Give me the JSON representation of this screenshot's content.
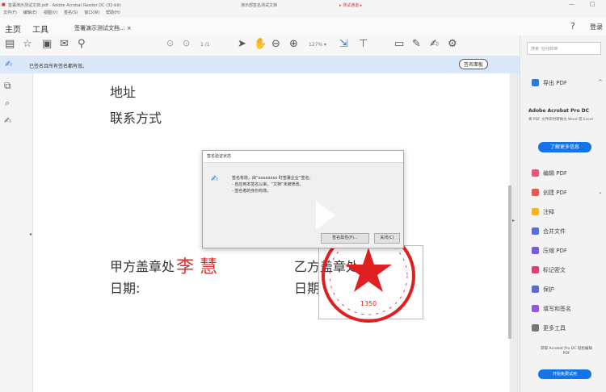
{
  "window": {
    "title": "签署演示测试文档.pdf - Adobe Acrobat Reader DC (32-bit)",
    "center_title": "演示部签名测试文档",
    "tab_status": "▸ 测试通道 ▸"
  },
  "menu": [
    "文件(F)",
    "编辑(E)",
    "视图(V)",
    "签名(S)",
    "窗口(W)",
    "帮助(H)"
  ],
  "tabs": {
    "home": "主页",
    "tools": "工具",
    "document": "签署演示测试文档... ×",
    "login": "登录"
  },
  "toolbar": {
    "page": "1 /1",
    "zoom": "127% ▾"
  },
  "notice": {
    "text": "已签名且所有签名都有效。",
    "panel_button": "签名面板"
  },
  "document": {
    "address": "地址",
    "contact": "联系方式",
    "party_a_seal": "甲方盖章处",
    "party_b_seal": "乙方盖章处",
    "date_label_a": "日期:",
    "date_label_b": "日期",
    "signature": "李 慧",
    "stamp_code": "1350"
  },
  "dialog": {
    "title": "签名验证状态",
    "lines": [
      "签名有效，由“xxxxxxxx 盯签署企业”签名。",
      "- 自应用本签名以来，“文档”未被修改。",
      "- 签名者的身份有效。"
    ],
    "props_button": "签名属性(P)...",
    "close_button": "关闭(C)"
  },
  "right_panel": {
    "search_placeholder": "搜索 '在线转换'",
    "export_pdf": "导出 PDF",
    "promo_title": "Adobe Acrobat Pro DC",
    "promo_text": "将 PDF 文件即时转换为 Word 或 Excel",
    "promo_button": "了解更多信息",
    "items": [
      "编辑 PDF",
      "创建 PDF",
      "注释",
      "合并文件",
      "压缩 PDF",
      "标记密文",
      "保护",
      "填写和签名",
      "更多工具"
    ],
    "footer_text": "获取 Acrobat Pro DC 轻松编辑 PDF",
    "footer_button": "开始免费试用"
  },
  "colors": {
    "accent": "#1473e6",
    "notice_bg": "#dbe8f9",
    "stamp": "#e02020",
    "signature": "#d83030"
  }
}
